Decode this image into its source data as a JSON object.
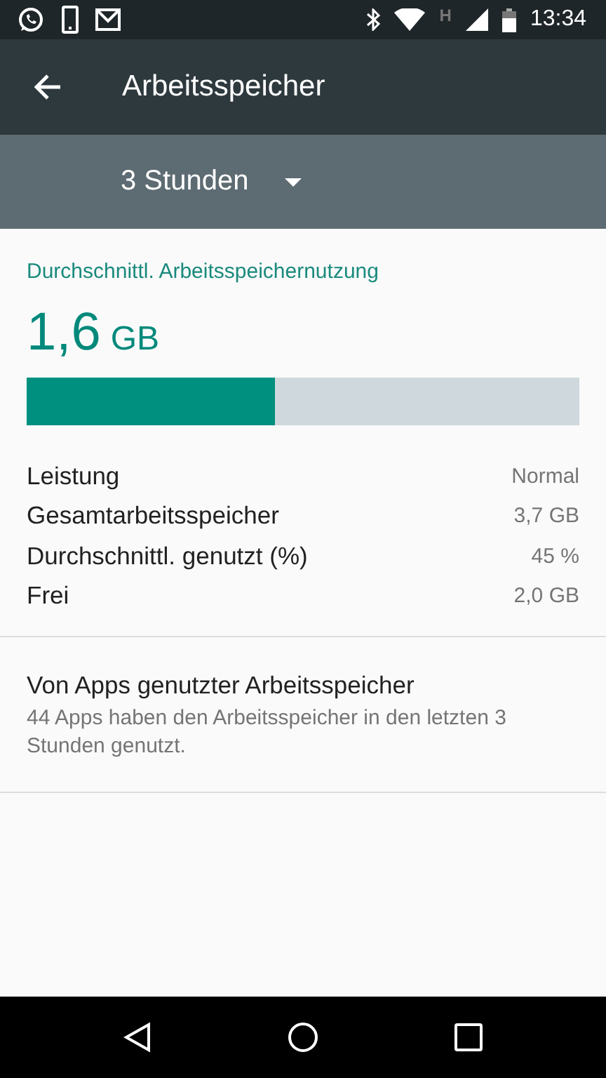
{
  "status_bar": {
    "network_type": "H",
    "time": "13:34"
  },
  "app_bar": {
    "title": "Arbeitsspeicher"
  },
  "period_selector": {
    "value": "3 Stunden"
  },
  "summary": {
    "heading": "Durchschnittl. Arbeitsspeichernutzung",
    "amount": "1,6",
    "unit": "GB",
    "level": 0.45
  },
  "stats": [
    {
      "label": "Leistung",
      "value": "Normal"
    },
    {
      "label": "Gesamtarbeitsspeicher",
      "value": "3,7 GB"
    },
    {
      "label": "Durchschnittl. genutzt (%)",
      "value": "45 %"
    },
    {
      "label": "Frei",
      "value": "2,0 GB"
    }
  ],
  "apps_entry": {
    "title": "Von Apps genutzter Arbeitsspeicher",
    "summary": "44 Apps haben den Arbeitsspeicher in den letzten 3 Stunden genutzt."
  }
}
